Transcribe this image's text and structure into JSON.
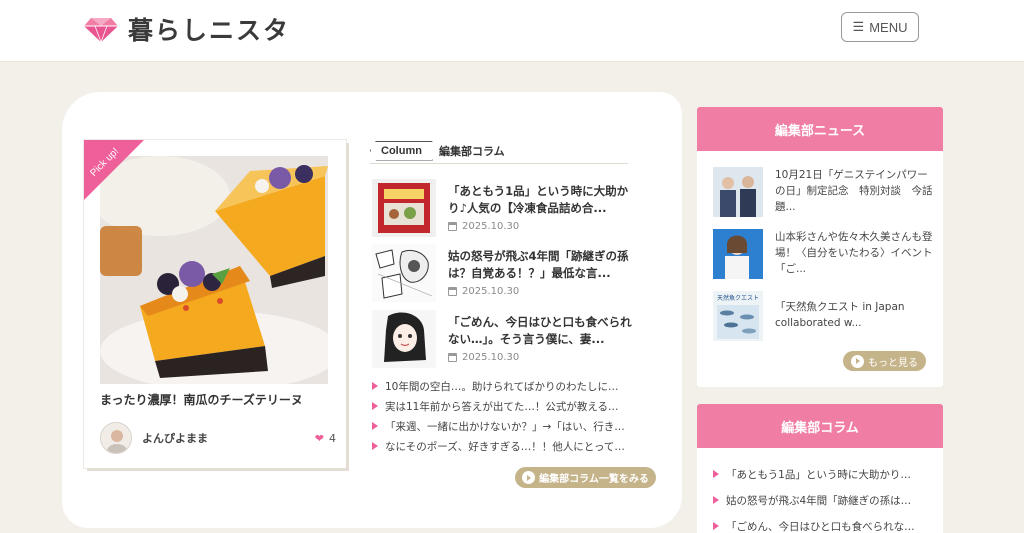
{
  "header": {
    "logo_text": "暮らしニスタ",
    "menu_label": "MENU",
    "menu_icon": "hamburger-icon"
  },
  "pickup": {
    "ribbon": "Pick up!",
    "title": "まったり濃厚！南瓜のチーズテリーヌ",
    "author": "よんぴよまま",
    "likes": "4"
  },
  "column": {
    "tag": "Column",
    "subtitle": "編集部コラム",
    "articles": [
      {
        "title": "「あともう1品」という時に大助かり♪人気の【冷凍食品詰め合...",
        "date": "2025.10.30"
      },
      {
        "title": "姑の怒号が飛ぶ4年間「跡継ぎの孫は？自覚ある！？」最低な言...",
        "date": "2025.10.30"
      },
      {
        "title": "「ごめん、今日はひと口も食べられない…」。そう言う僕に、妻...",
        "date": "2025.10.30"
      }
    ],
    "links": [
      "10年間の空白…。助けられてばかりのわたしに…",
      "実は11年前から答えが出てた…！公式が教える…",
      "「来週、一緒に出かけないか？」→「はい、行き…",
      "なにそのポーズ、好きすぎる…！！他人にとって…"
    ],
    "more_label": "編集部コラム一覧をみる"
  },
  "sidebar": {
    "news": {
      "heading": "編集部ニュース",
      "items": [
        "10月21日「ゲニステインパワーの日」制定記念　特別対談　今話題...",
        "山本彩さんや佐々木久美さんも登場！〈自分をいたわる〉イベント「ご...",
        "「天然魚クエスト in Japan collaborated w..."
      ],
      "more_label": "もっと見る"
    },
    "column": {
      "heading": "編集部コラム",
      "links": [
        "「あともう1品」という時に大助かり…",
        "姑の怒号が飛ぶ4年間「跡継ぎの孫は…",
        "「ごめん、今日はひと口も食べられな…"
      ]
    }
  },
  "thumb3_text": "天然魚クエスト",
  "colors": {
    "accent_pink": "#ef5f9a",
    "sidebar_header": "#f07ea4",
    "gold_button": "#c5b48a",
    "background": "#f3efe9"
  }
}
